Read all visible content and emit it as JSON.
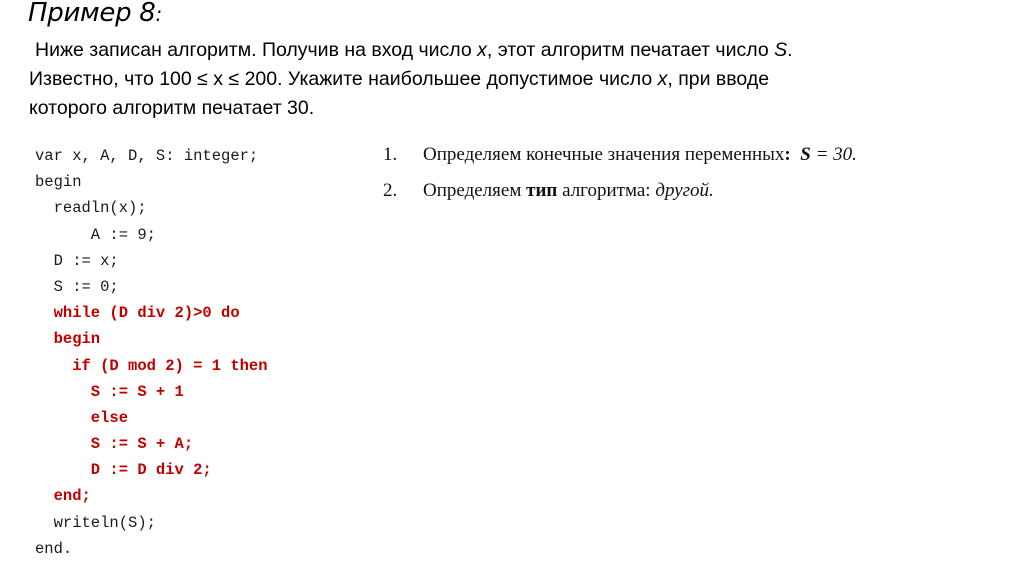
{
  "title": {
    "text": "Пример 8",
    "suffix": ":"
  },
  "problem": {
    "line1_a": "Ниже записан алгоритм. Получив на вход число ",
    "line1_var_x": "x",
    "line1_b": ", этот алгоритм печатает число ",
    "line1_var_s": "S",
    "line1_c": ".",
    "line2_a": "Известно, что 100 ≤ x ≤ 200. Укажите наибольшее допустимое число ",
    "line2_var_x": "x",
    "line2_b": ", при вводе",
    "line3": "которого алгоритм печатает 30."
  },
  "code": {
    "lines": [
      {
        "text": "var x, A, D, S: integer;",
        "indent": "",
        "highlight": false
      },
      {
        "text": "begin",
        "indent": "",
        "highlight": false
      },
      {
        "text": "readln(x);",
        "indent": "  ",
        "highlight": false
      },
      {
        "text": "A := 9;",
        "indent": "      ",
        "highlight": false
      },
      {
        "text": "D := x;",
        "indent": "  ",
        "highlight": false
      },
      {
        "text": "S := 0;",
        "indent": "  ",
        "highlight": false
      },
      {
        "text": "while (D div 2)>0 do",
        "indent": "  ",
        "highlight": true
      },
      {
        "text": "begin",
        "indent": "  ",
        "highlight": true
      },
      {
        "text": "if (D mod 2) = 1 then",
        "indent": "    ",
        "highlight": true
      },
      {
        "text": "S := S + 1",
        "indent": "      ",
        "highlight": true
      },
      {
        "text": "else",
        "indent": "      ",
        "highlight": true
      },
      {
        "text": "S := S + A;",
        "indent": "      ",
        "highlight": true
      },
      {
        "text": "D := D div 2;",
        "indent": "      ",
        "highlight": true
      },
      {
        "text": "end;",
        "indent": "  ",
        "highlight": true
      },
      {
        "text": "writeln(S);",
        "indent": "  ",
        "highlight": false
      },
      {
        "text": "end.",
        "indent": "",
        "highlight": false
      }
    ]
  },
  "steps": [
    {
      "number": "1.",
      "text": "Определяем конечные значения переменных",
      "bold_suffix": ":",
      "value_bold": "S",
      "value_rest": " = 30."
    },
    {
      "number": "2.",
      "text_a": "Определяем ",
      "text_bold": "тип",
      "text_b": " алгоритма:  ",
      "value_italic": "другой."
    }
  ],
  "colors": {
    "highlight_code": "#c00000",
    "text": "#000000"
  }
}
